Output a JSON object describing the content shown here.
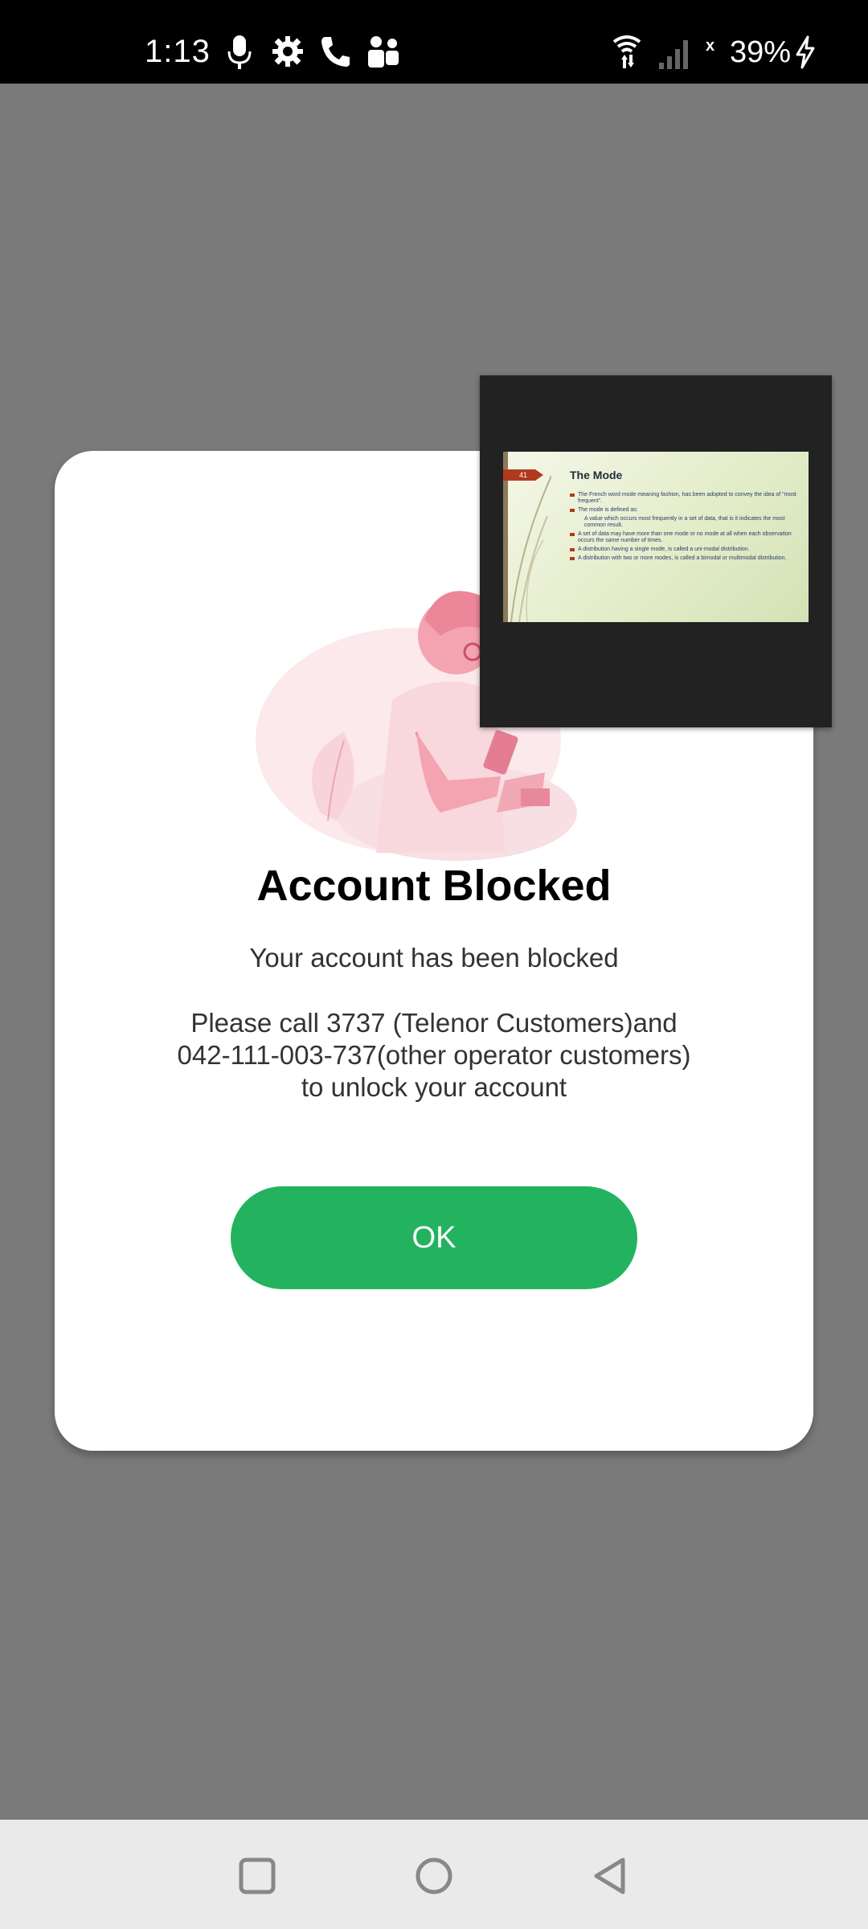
{
  "status_bar": {
    "time": "1:13",
    "battery_text": "39%",
    "signal_marker": "x",
    "icons": [
      "microphone-icon",
      "settings-gear-icon",
      "phone-call-icon",
      "teams-icon",
      "wifi-icon",
      "cell-signal-icon",
      "charging-bolt-icon"
    ]
  },
  "dialog": {
    "title": "Account Blocked",
    "subtitle": "Your account has been blocked",
    "message_line1": "Please call 3737 (Telenor Customers)and",
    "message_line2": "042-111-003-737(other operator customers)",
    "message_line3": "to unlock your account",
    "ok_label": "OK",
    "ok_color": "#23b35f"
  },
  "pip": {
    "slide_number": "41",
    "slide_title": "The Mode",
    "slide_lines": [
      {
        "text": "The French word mode meaning fashion, has been adopted to convey the idea of \"most frequent\".",
        "sub": false
      },
      {
        "text": "The mode is defined as:",
        "sub": false
      },
      {
        "text": "A value which occurs most frequently in a set of data, that is it indicates the most common result.",
        "sub": true
      },
      {
        "text": "A set of data may have more than one mode or no mode at all when each observation occurs the same number of times.",
        "sub": false
      },
      {
        "text": "A distribution having a single mode, is called a uni-modal distribution.",
        "sub": false
      },
      {
        "text": "A distribution with two or more modes, is called a bimodal or multimodal distribution.",
        "sub": false
      }
    ]
  },
  "nav_bar": {
    "buttons": [
      "recents-square-icon",
      "home-circle-icon",
      "back-triangle-icon"
    ]
  }
}
